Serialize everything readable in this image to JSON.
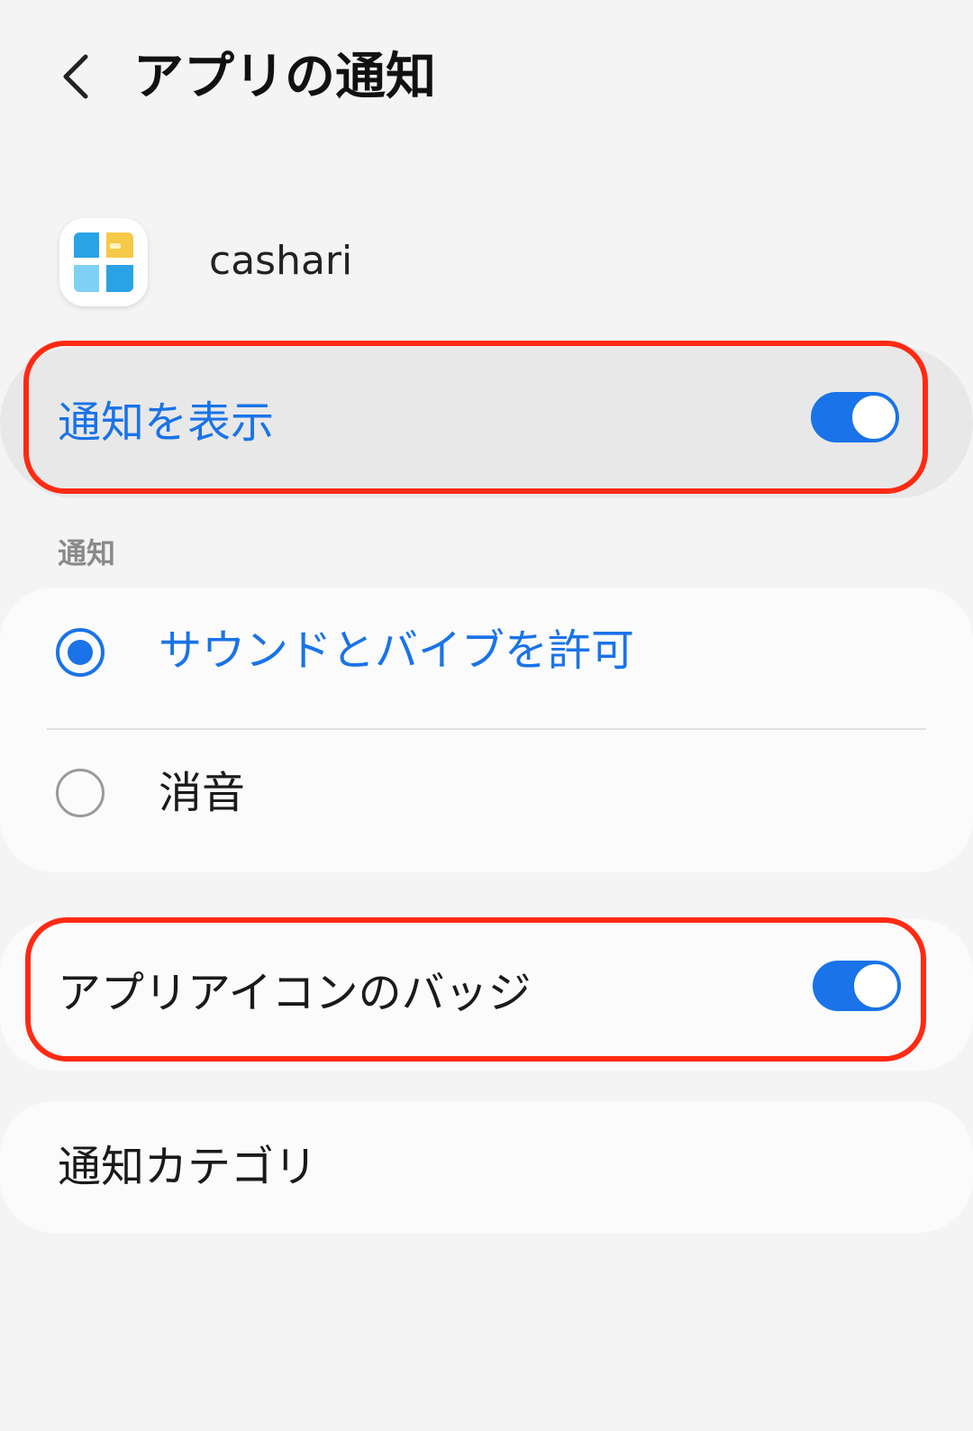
{
  "header": {
    "title": "アプリの通知"
  },
  "app": {
    "name": "cashari",
    "icon": "cashari-app-icon"
  },
  "show_notifications": {
    "label": "通知を表示",
    "enabled": true
  },
  "notifications_section": {
    "label": "通知",
    "options": [
      {
        "label": "サウンドとバイブを許可",
        "selected": true
      },
      {
        "label": "消音",
        "selected": false
      }
    ]
  },
  "app_icon_badge": {
    "label": "アプリアイコンのバッジ",
    "enabled": true
  },
  "notification_categories": {
    "label": "通知カテゴリ"
  },
  "colors": {
    "accent": "#1a73e8",
    "highlight": "#ff2a14",
    "background": "#f4f4f4"
  }
}
